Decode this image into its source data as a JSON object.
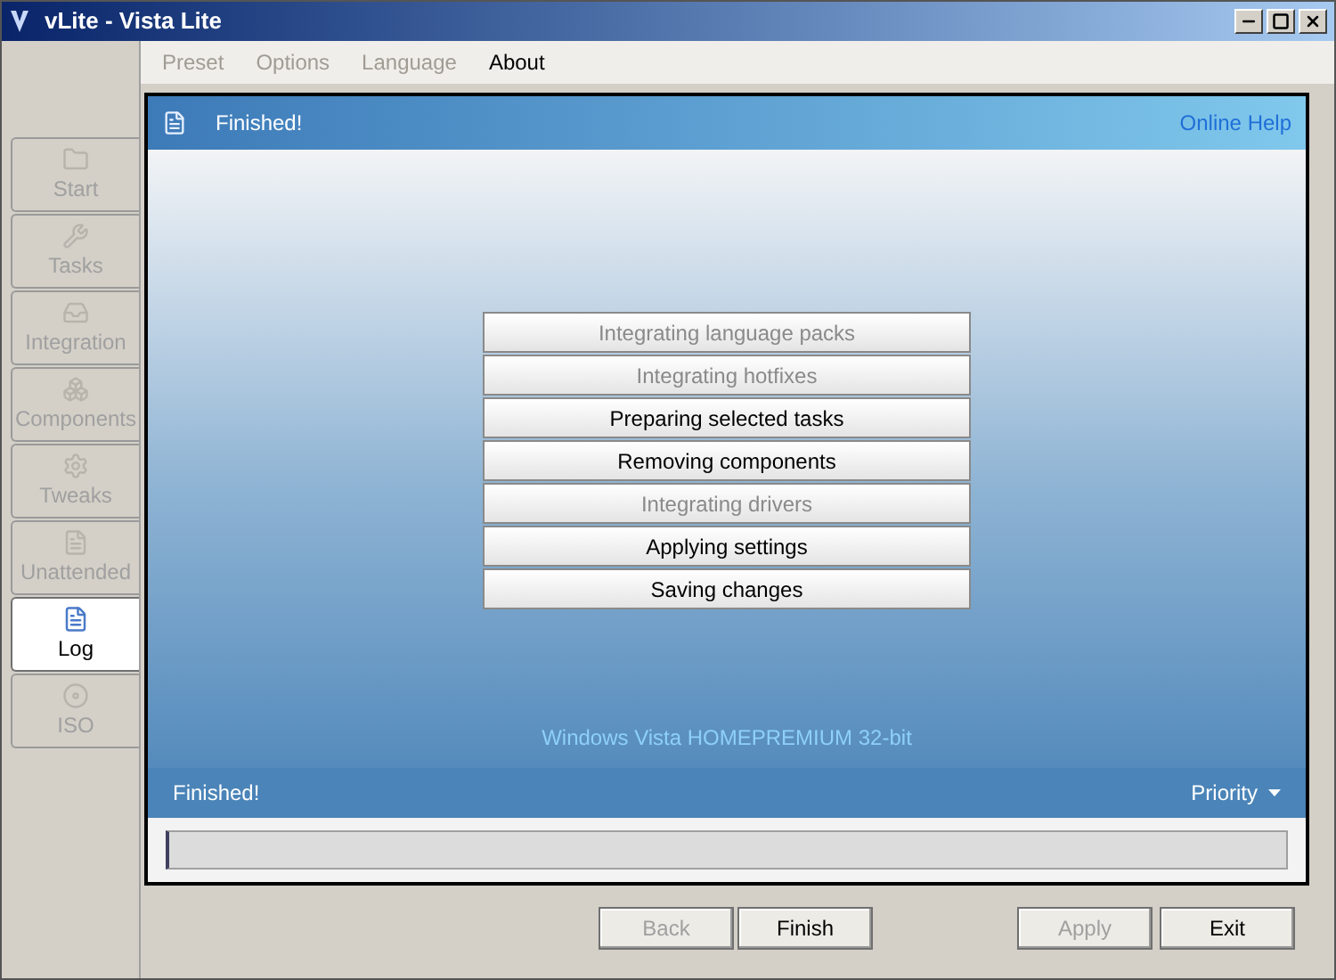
{
  "window": {
    "title": "vLite - Vista Lite"
  },
  "menu": [
    {
      "label": "Preset",
      "disabled": true
    },
    {
      "label": "Options",
      "disabled": true
    },
    {
      "label": "Language",
      "disabled": true
    },
    {
      "label": "About",
      "disabled": false
    }
  ],
  "sidebar": {
    "items": [
      {
        "label": "Start",
        "selected": false
      },
      {
        "label": "Tasks",
        "selected": false
      },
      {
        "label": "Integration",
        "selected": false
      },
      {
        "label": "Components",
        "selected": false
      },
      {
        "label": "Tweaks",
        "selected": false
      },
      {
        "label": "Unattended",
        "selected": false
      },
      {
        "label": "Log",
        "selected": true
      },
      {
        "label": "ISO",
        "selected": false
      }
    ]
  },
  "header": {
    "title": "Finished!",
    "link": "Online Help"
  },
  "tasks": [
    {
      "label": "Integrating language packs",
      "disabled": true
    },
    {
      "label": "Integrating hotfixes",
      "disabled": true
    },
    {
      "label": "Preparing selected tasks",
      "disabled": false
    },
    {
      "label": "Removing components",
      "disabled": false
    },
    {
      "label": "Integrating drivers",
      "disabled": true
    },
    {
      "label": "Applying settings",
      "disabled": false
    },
    {
      "label": "Saving changes",
      "disabled": false
    }
  ],
  "edition": "Windows Vista HOMEPREMIUM 32-bit",
  "status": {
    "text": "Finished!",
    "priority": "Priority"
  },
  "progress": {
    "level": 0
  },
  "buttons": [
    {
      "label": "Back",
      "disabled": true
    },
    {
      "label": "Finish",
      "disabled": false
    },
    {
      "label": "Apply",
      "disabled": true
    },
    {
      "label": "Exit",
      "disabled": false
    }
  ]
}
